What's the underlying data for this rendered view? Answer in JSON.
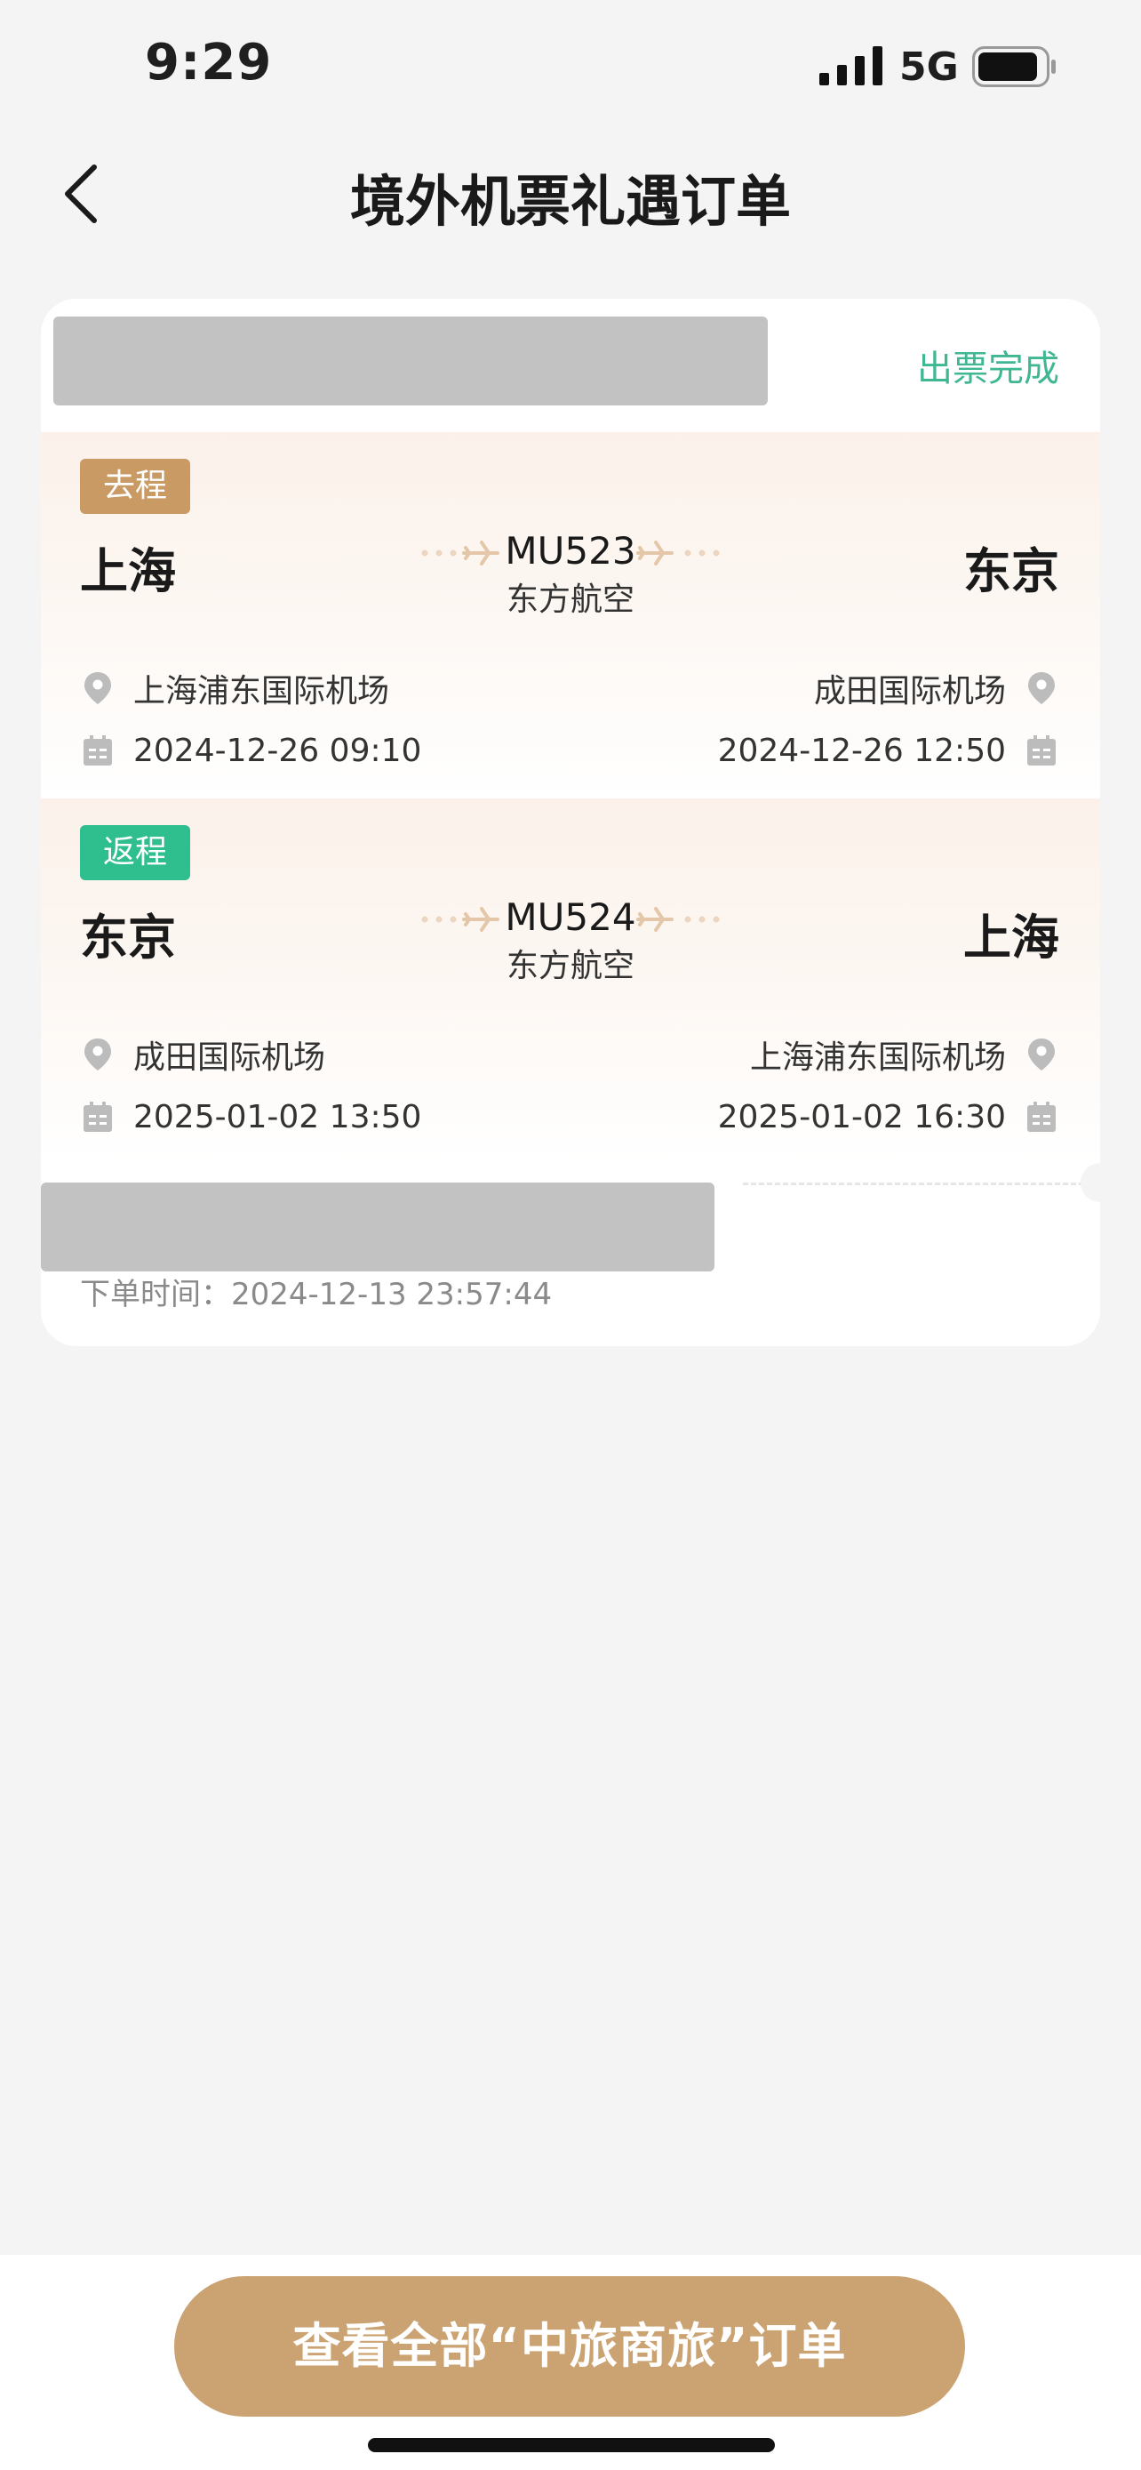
{
  "status_bar": {
    "time": "9:29",
    "network": "5G"
  },
  "header": {
    "title": "境外机票礼遇订单"
  },
  "order": {
    "status": "出票完成",
    "order_time_label": "下单时间：",
    "order_time": "2024-12-13 23:57:44",
    "trips": [
      {
        "tag": "去程",
        "from_city": "上海",
        "to_city": "东京",
        "flight_no": "MU523",
        "airline": "东方航空",
        "from_airport": "上海浦东国际机场",
        "to_airport": "成田国际机场",
        "depart_time": "2024-12-26 09:10",
        "arrive_time": "2024-12-26 12:50"
      },
      {
        "tag": "返程",
        "from_city": "东京",
        "to_city": "上海",
        "flight_no": "MU524",
        "airline": "东方航空",
        "from_airport": "成田国际机场",
        "to_airport": "上海浦东国际机场",
        "depart_time": "2025-01-02 13:50",
        "arrive_time": "2025-01-02 16:30"
      }
    ]
  },
  "footer": {
    "button_label": "查看全部“中旅商旅”订单"
  },
  "colors": {
    "accent_gold": "#cba271",
    "status_green": "#3fb793",
    "tag_green": "#2fbf8f"
  }
}
